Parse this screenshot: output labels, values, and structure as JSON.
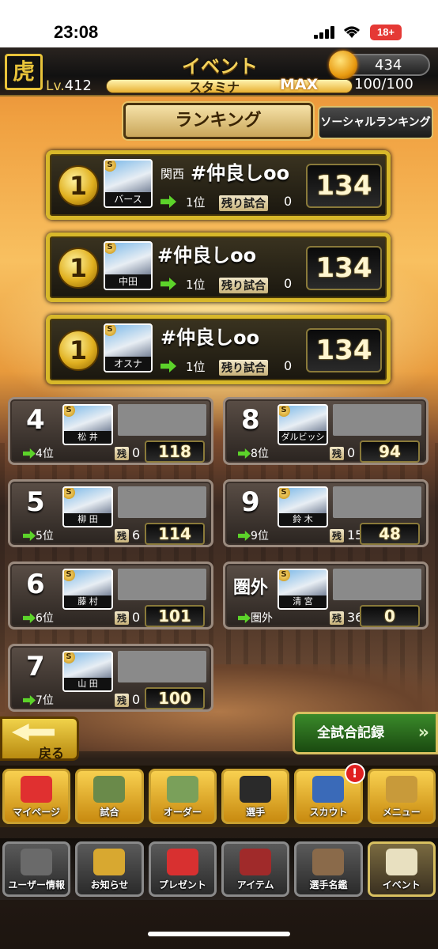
{
  "status": {
    "time": "23:08",
    "battery": "18+"
  },
  "header": {
    "logo_text": "虎",
    "title": "イベント",
    "coins": "434",
    "level_label": "Lv.",
    "level": "412",
    "stamina_label": "スタミナ",
    "stamina_state": "MAX",
    "stamina_value": "100/100",
    "stamina_fraction": 1.0
  },
  "tabs": {
    "ranking": "ランキング",
    "social": "ソーシャルランキング"
  },
  "top_ranks": [
    {
      "rank": "1",
      "team": "関西",
      "name": "#仲良しoo",
      "player": "バース",
      "prev_rank": "1位",
      "remaining_label": "残り試合",
      "remaining": "0",
      "score": "134"
    },
    {
      "rank": "1",
      "team": "",
      "name": "#仲良しoo",
      "player": "中田",
      "prev_rank": "1位",
      "remaining_label": "残り試合",
      "remaining": "0",
      "score": "134"
    },
    {
      "rank": "1",
      "team": "",
      "name": "#仲良しoo",
      "player": "オスナ",
      "prev_rank": "1位",
      "remaining_label": "残り試合",
      "remaining": "0",
      "score": "134"
    }
  ],
  "ranks": [
    {
      "rank": "4",
      "player": "松 井",
      "prev_rank": "4位",
      "remaining_label": "残",
      "remaining": "0",
      "score": "118"
    },
    {
      "rank": "8",
      "player": "ダルビッシュ",
      "prev_rank": "8位",
      "remaining_label": "残",
      "remaining": "0",
      "score": "94"
    },
    {
      "rank": "5",
      "player": "柳 田",
      "prev_rank": "5位",
      "remaining_label": "残",
      "remaining": "6",
      "score": "114"
    },
    {
      "rank": "9",
      "player": "鈴 木",
      "prev_rank": "9位",
      "remaining_label": "残",
      "remaining": "15",
      "score": "48"
    },
    {
      "rank": "6",
      "player": "藤 村",
      "prev_rank": "6位",
      "remaining_label": "残",
      "remaining": "0",
      "score": "101"
    },
    {
      "rank": "圏外",
      "player": "清 宮",
      "prev_rank": "圏外",
      "remaining_label": "残",
      "remaining": "36",
      "score": "0"
    },
    {
      "rank": "7",
      "player": "山 田",
      "prev_rank": "7位",
      "remaining_label": "残",
      "remaining": "0",
      "score": "100"
    }
  ],
  "buttons": {
    "back": "戻る",
    "records": "全試合記録"
  },
  "menu_top": [
    {
      "label": "マイページ",
      "icon": "mypage-icon",
      "color": "#e03030"
    },
    {
      "label": "試合",
      "icon": "stadium-icon",
      "color": "#6a8a4a"
    },
    {
      "label": "オーダー",
      "icon": "field-icon",
      "color": "#7aa05a"
    },
    {
      "label": "選手",
      "icon": "player-icon",
      "color": "#2a2a2a"
    },
    {
      "label": "スカウト",
      "icon": "scout-icon",
      "color": "#3a6ab8"
    },
    {
      "label": "メニュー",
      "icon": "menu-icon",
      "color": "#c89a3a"
    }
  ],
  "scout_badge": "!",
  "menu_bottom": [
    {
      "label": "ユーザー情報",
      "icon": "user-info-icon",
      "color": "#6a6a6a"
    },
    {
      "label": "お知らせ",
      "icon": "notice-icon",
      "color": "#d8a830"
    },
    {
      "label": "プレゼント",
      "icon": "present-icon",
      "color": "#d83030"
    },
    {
      "label": "アイテム",
      "icon": "item-icon",
      "color": "#a02a2a"
    },
    {
      "label": "選手名鑑",
      "icon": "directory-icon",
      "color": "#8a6a4a"
    },
    {
      "label": "イベント",
      "icon": "event-icon",
      "color": "#e8e0c0"
    }
  ]
}
